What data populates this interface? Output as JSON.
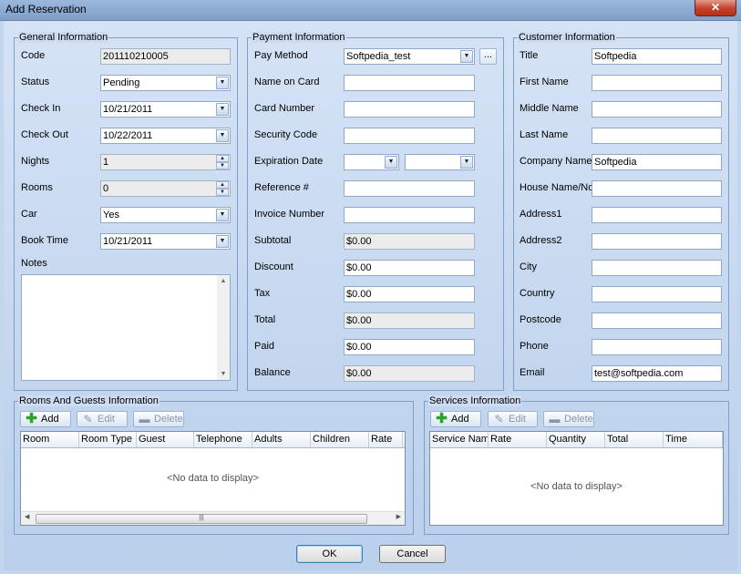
{
  "window": {
    "title": "Add Reservation",
    "close_glyph": "✕"
  },
  "general": {
    "title": "General Information",
    "code_label": "Code",
    "code_value": "201110210005",
    "status_label": "Status",
    "status_value": "Pending",
    "checkin_label": "Check In",
    "checkin_value": "10/21/2011",
    "checkout_label": "Check Out",
    "checkout_value": "10/22/2011",
    "nights_label": "Nights",
    "nights_value": "1",
    "rooms_label": "Rooms",
    "rooms_value": "0",
    "car_label": "Car",
    "car_value": "Yes",
    "booktime_label": "Book Time",
    "booktime_value": "10/21/2011",
    "notes_label": "Notes"
  },
  "payment": {
    "title": "Payment Information",
    "paymethod_label": "Pay Method",
    "paymethod_value": "Softpedia_test",
    "browse_label": "...",
    "nameoncard_label": "Name on Card",
    "cardnumber_label": "Card Number",
    "securitycode_label": "Security Code",
    "expiration_label": "Expiration Date",
    "reference_label": "Reference #",
    "invoice_label": "Invoice Number",
    "subtotal_label": "Subtotal",
    "subtotal_value": "$0.00",
    "discount_label": "Discount",
    "discount_value": "$0.00",
    "tax_label": "Tax",
    "tax_value": "$0.00",
    "total_label": "Total",
    "total_value": "$0.00",
    "paid_label": "Paid",
    "paid_value": "$0.00",
    "balance_label": "Balance",
    "balance_value": "$0.00"
  },
  "customer": {
    "title": "Customer Information",
    "fields": [
      {
        "label": "Title",
        "value": "Softpedia"
      },
      {
        "label": "First Name",
        "value": ""
      },
      {
        "label": "Middle Name",
        "value": ""
      },
      {
        "label": "Last Name",
        "value": ""
      },
      {
        "label": "Company Name",
        "value": "Softpedia"
      },
      {
        "label": "House Name/No",
        "value": ""
      },
      {
        "label": "Address1",
        "value": ""
      },
      {
        "label": "Address2",
        "value": ""
      },
      {
        "label": "City",
        "value": ""
      },
      {
        "label": "Country",
        "value": ""
      },
      {
        "label": "Postcode",
        "value": ""
      },
      {
        "label": "Phone",
        "value": ""
      },
      {
        "label": "Email",
        "value": "test@softpedia.com"
      }
    ]
  },
  "rooms": {
    "title": "Rooms And Guests Information",
    "add_label": "Add",
    "edit_label": "Edit",
    "delete_label": "Delete",
    "columns": [
      "Room",
      "Room Type",
      "Guest",
      "Telephone",
      "Adults",
      "Children",
      "Rate"
    ],
    "empty_text": "<No data to display>"
  },
  "services": {
    "title": "Services Information",
    "add_label": "Add",
    "edit_label": "Edit",
    "delete_label": "Delete",
    "columns": [
      "Service Nam",
      "Rate",
      "Quantity",
      "Total",
      "Time"
    ],
    "empty_text": "<No data to display>"
  },
  "buttons": {
    "ok_label": "OK",
    "cancel_label": "Cancel"
  },
  "colors": {
    "titlebar": "#8faad2",
    "close": "#c4402a",
    "background": "#c2d6ee",
    "border": "#7f9fc8"
  }
}
